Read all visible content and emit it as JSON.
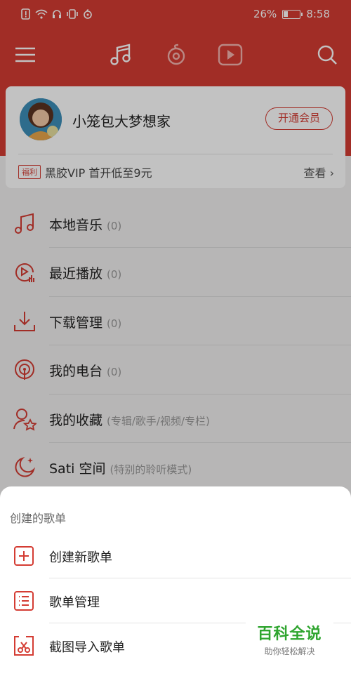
{
  "status_bar": {
    "battery_percent": "26%",
    "battery_level": 0.26,
    "time": "8:58"
  },
  "nav": {
    "icons": [
      "menu-icon",
      "music-icon",
      "netease-cloud-icon",
      "video-play-icon",
      "search-icon"
    ]
  },
  "profile": {
    "username": "小笼包大梦想家",
    "vip_button": "开通会员",
    "welfare_tag": "福利",
    "promo_text": "黑胶VIP 首开低至9元",
    "look_link": "查看",
    "chevron": "›"
  },
  "menu": {
    "items": [
      {
        "label": "本地音乐",
        "count": "(0)",
        "icon": "music-note-icon"
      },
      {
        "label": "最近播放",
        "count": "(0)",
        "icon": "recent-play-icon"
      },
      {
        "label": "下载管理",
        "count": "(0)",
        "icon": "download-icon"
      },
      {
        "label": "我的电台",
        "count": "(0)",
        "icon": "radio-icon"
      },
      {
        "label": "我的收藏",
        "count": "(专辑/歌手/视频/专栏)",
        "icon": "favorite-user-icon"
      },
      {
        "label": "Sati 空间",
        "count": "(特别的聆听模式)",
        "icon": "moon-icon"
      }
    ]
  },
  "sheet": {
    "title": "创建的歌单",
    "items": [
      {
        "label": "创建新歌单",
        "icon": "add-box-icon"
      },
      {
        "label": "歌单管理",
        "icon": "list-manage-icon"
      },
      {
        "label": "截图导入歌单",
        "icon": "screenshot-import-icon"
      }
    ]
  },
  "watermark": {
    "title": "百科全说",
    "subtitle": "助你轻松解决"
  },
  "colors": {
    "brand_red": "#d43c33",
    "watermark_green": "#2fa52f"
  }
}
